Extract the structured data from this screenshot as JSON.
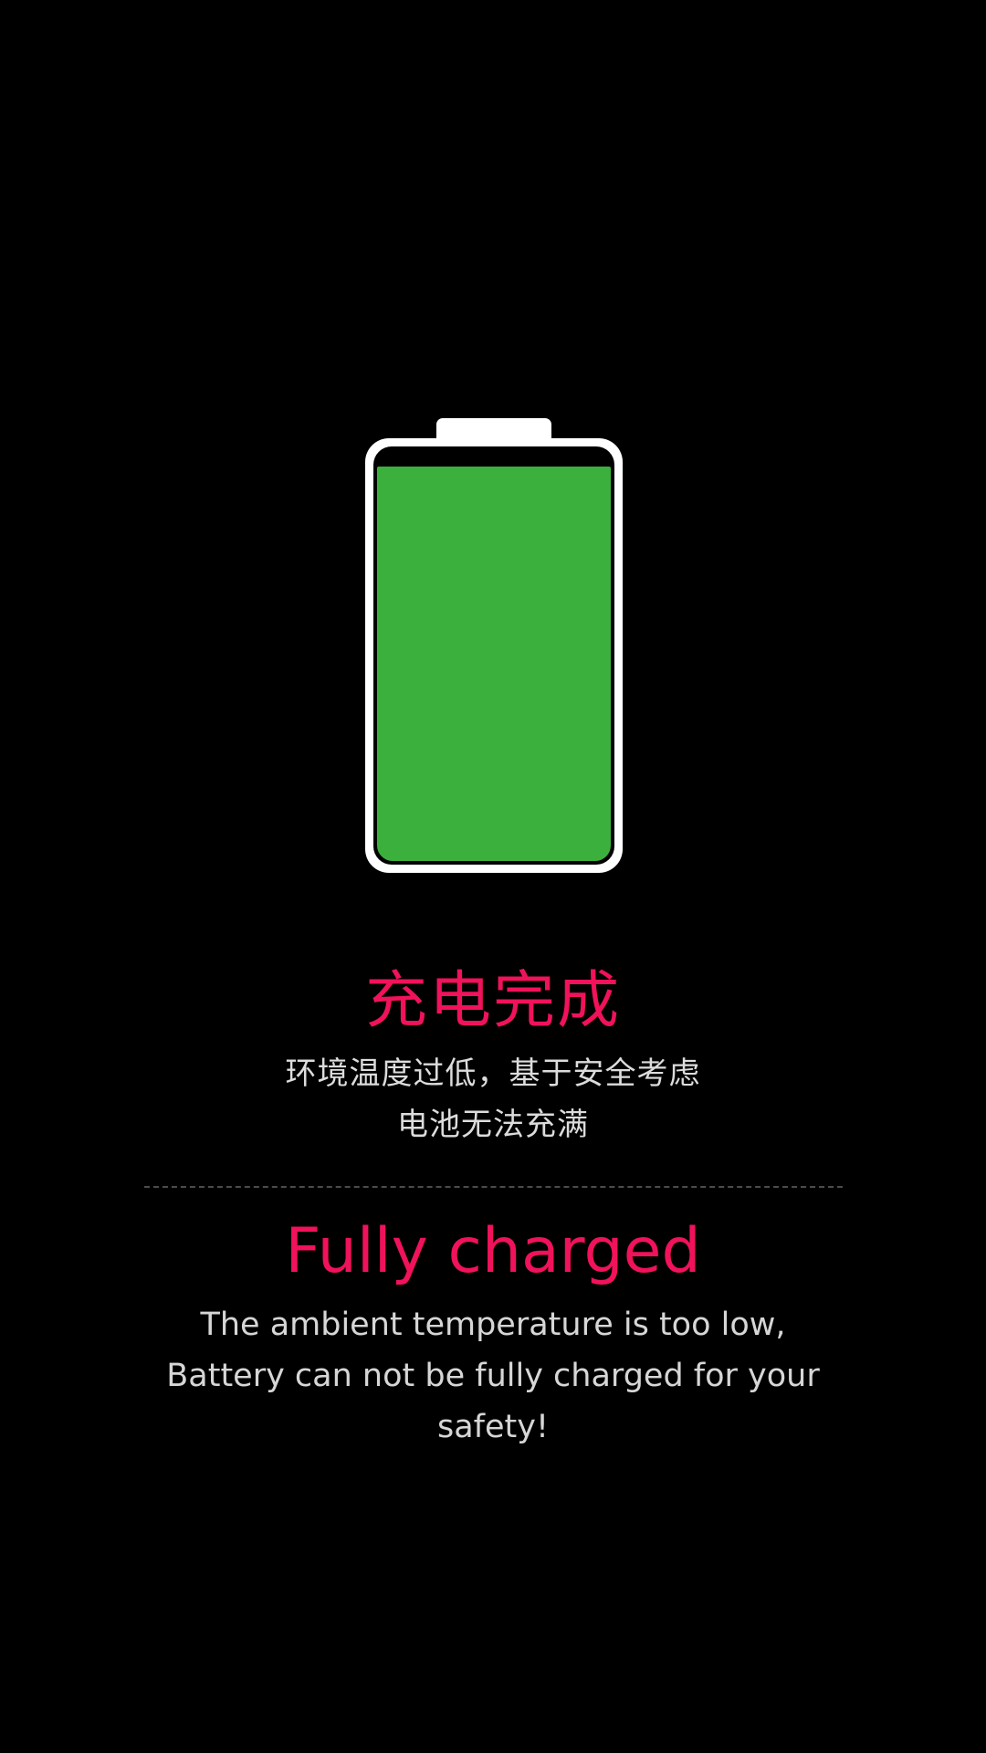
{
  "battery": {
    "level": 1.0,
    "fill_color": "#3cb03c",
    "outline_color": "#ffffff",
    "icon": "battery-full-icon"
  },
  "status_cn": {
    "title": "充电完成",
    "message_line1": "环境温度过低，基于安全考虑",
    "message_line2": "电池无法充满"
  },
  "status_en": {
    "title": "Fully charged",
    "message": "The ambient temperature is too low, Battery can not be fully charged for your safety!"
  },
  "colors": {
    "background": "#000000",
    "accent": "#f0125a",
    "text": "#dcdcdc"
  }
}
